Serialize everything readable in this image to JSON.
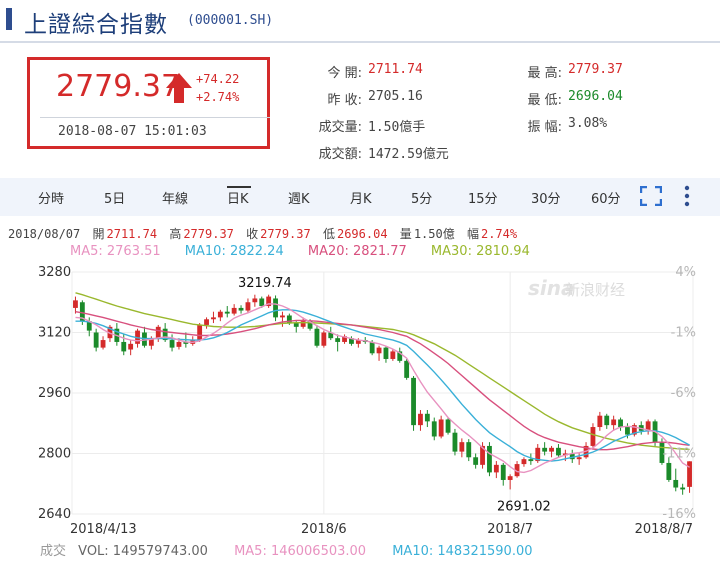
{
  "header": {
    "title": "上證綜合指數",
    "code": "(000001.SH)"
  },
  "quote": {
    "price": "2779.37",
    "change": "+74.22",
    "change_pct": "+2.74%",
    "time": "2018-08-07 15:01:03"
  },
  "stats": [
    {
      "label": "今 開:",
      "value": "2711.74",
      "tone": "red"
    },
    {
      "label": "昨 收:",
      "value": "2705.16",
      "tone": "dark"
    },
    {
      "label": "成交量:",
      "value": "1.50億手",
      "tone": "dark"
    },
    {
      "label": "成交額:",
      "value": "1472.59億元",
      "tone": "dark"
    },
    {
      "label": "最 高:",
      "value": "2779.37",
      "tone": "red"
    },
    {
      "label": "最 低:",
      "value": "2696.04",
      "tone": "green"
    },
    {
      "label": "振 幅:",
      "value": "3.08%",
      "tone": "dark"
    }
  ],
  "tabs": [
    "分時",
    "5日",
    "年線",
    "日K",
    "週K",
    "月K",
    "5分",
    "15分",
    "30分",
    "60分"
  ],
  "active_tab": "日K",
  "info_line": {
    "date": "2018/08/07",
    "open_label": "開",
    "open": "2711.74",
    "high_label": "高",
    "high": "2779.37",
    "close_label": "收",
    "close": "2779.37",
    "low_label": "低",
    "low": "2696.04",
    "vol_label": "量",
    "vol": "1.50億",
    "amp_label": "幅",
    "amp": "2.74%"
  },
  "ma_legend": {
    "ma5": "MA5: 2763.51",
    "ma10": "MA10: 2822.24",
    "ma20": "MA20: 2821.77",
    "ma30": "MA30: 2810.94"
  },
  "volume_line": {
    "label": "成交",
    "vol": "VOL: 149579743.00",
    "ma5": "MA5: 146006503.00",
    "ma10": "MA10: 148321590.00"
  },
  "watermark": "新浪财经",
  "colors": {
    "up": "#d42a2a",
    "down": "#1b8a2a",
    "ma5": "#e892c0",
    "ma10": "#3ab0d8",
    "ma20": "#d8507e",
    "ma30": "#9ab82e",
    "accent": "#2e4d8f"
  },
  "chart_data": {
    "type": "candlestick",
    "ylim": [
      2640,
      3280
    ],
    "y_ticks": [
      "3280",
      "3120",
      "2960",
      "2800",
      "2640"
    ],
    "pct_ticks": [
      "4%",
      "-1%",
      "-6%",
      "-11%",
      "-16%"
    ],
    "x_ticks": [
      "2018/4/13",
      "2018/6",
      "2018/7",
      "2018/8/7"
    ],
    "annotations": {
      "high": "3219.74",
      "low": "2691.02"
    },
    "candles": [
      [
        3185,
        3215,
        3170,
        3205
      ],
      [
        3200,
        3205,
        3140,
        3150
      ],
      [
        3150,
        3160,
        3110,
        3125
      ],
      [
        3120,
        3130,
        3070,
        3080
      ],
      [
        3080,
        3110,
        3075,
        3100
      ],
      [
        3105,
        3140,
        3095,
        3135
      ],
      [
        3130,
        3145,
        3085,
        3095
      ],
      [
        3095,
        3115,
        3060,
        3070
      ],
      [
        3075,
        3100,
        3060,
        3090
      ],
      [
        3090,
        3130,
        3080,
        3125
      ],
      [
        3120,
        3135,
        3080,
        3085
      ],
      [
        3085,
        3110,
        3075,
        3105
      ],
      [
        3105,
        3140,
        3095,
        3135
      ],
      [
        3130,
        3145,
        3095,
        3100
      ],
      [
        3100,
        3115,
        3070,
        3080
      ],
      [
        3082,
        3105,
        3075,
        3095
      ],
      [
        3095,
        3120,
        3080,
        3090
      ],
      [
        3090,
        3110,
        3085,
        3100
      ],
      [
        3100,
        3145,
        3095,
        3140
      ],
      [
        3140,
        3160,
        3130,
        3155
      ],
      [
        3155,
        3175,
        3145,
        3160
      ],
      [
        3160,
        3180,
        3150,
        3175
      ],
      [
        3175,
        3190,
        3160,
        3170
      ],
      [
        3170,
        3195,
        3165,
        3185
      ],
      [
        3185,
        3192,
        3170,
        3178
      ],
      [
        3178,
        3210,
        3172,
        3200
      ],
      [
        3200,
        3220,
        3188,
        3210
      ],
      [
        3210,
        3215,
        3185,
        3190
      ],
      [
        3190,
        3220,
        3185,
        3215
      ],
      [
        3210,
        3218,
        3150,
        3160
      ],
      [
        3160,
        3175,
        3135,
        3165
      ],
      [
        3165,
        3170,
        3140,
        3145
      ],
      [
        3145,
        3150,
        3120,
        3135
      ],
      [
        3135,
        3160,
        3130,
        3150
      ],
      [
        3150,
        3155,
        3125,
        3130
      ],
      [
        3130,
        3140,
        3080,
        3085
      ],
      [
        3085,
        3125,
        3080,
        3120
      ],
      [
        3120,
        3135,
        3100,
        3105
      ],
      [
        3105,
        3115,
        3070,
        3095
      ],
      [
        3095,
        3115,
        3090,
        3110
      ],
      [
        3105,
        3110,
        3085,
        3090
      ],
      [
        3090,
        3105,
        3080,
        3100
      ],
      [
        3100,
        3108,
        3090,
        3095
      ],
      [
        3095,
        3100,
        3060,
        3065
      ],
      [
        3065,
        3085,
        3045,
        3080
      ],
      [
        3080,
        3085,
        3040,
        3050
      ],
      [
        3050,
        3075,
        3045,
        3070
      ],
      [
        3070,
        3080,
        3040,
        3045
      ],
      [
        3045,
        3050,
        2995,
        3000
      ],
      [
        3000,
        3005,
        2860,
        2875
      ],
      [
        2875,
        2915,
        2860,
        2905
      ],
      [
        2905,
        2915,
        2870,
        2885
      ],
      [
        2885,
        2895,
        2835,
        2845
      ],
      [
        2845,
        2900,
        2840,
        2890
      ],
      [
        2890,
        2895,
        2850,
        2855
      ],
      [
        2855,
        2865,
        2795,
        2805
      ],
      [
        2805,
        2840,
        2790,
        2830
      ],
      [
        2830,
        2838,
        2780,
        2790
      ],
      [
        2790,
        2800,
        2760,
        2770
      ],
      [
        2770,
        2830,
        2760,
        2820
      ],
      [
        2820,
        2830,
        2740,
        2750
      ],
      [
        2750,
        2780,
        2735,
        2770
      ],
      [
        2770,
        2775,
        2715,
        2730
      ],
      [
        2730,
        2745,
        2705,
        2740
      ],
      [
        2740,
        2780,
        2736,
        2772
      ],
      [
        2772,
        2790,
        2765,
        2785
      ],
      [
        2785,
        2800,
        2770,
        2780
      ],
      [
        2780,
        2825,
        2775,
        2815
      ],
      [
        2815,
        2830,
        2795,
        2805
      ],
      [
        2805,
        2820,
        2790,
        2815
      ],
      [
        2815,
        2825,
        2790,
        2795
      ],
      [
        2795,
        2810,
        2780,
        2800
      ],
      [
        2800,
        2810,
        2775,
        2785
      ],
      [
        2785,
        2800,
        2770,
        2790
      ],
      [
        2790,
        2830,
        2786,
        2820
      ],
      [
        2820,
        2880,
        2815,
        2870
      ],
      [
        2870,
        2910,
        2860,
        2900
      ],
      [
        2900,
        2905,
        2865,
        2875
      ],
      [
        2875,
        2900,
        2860,
        2890
      ],
      [
        2890,
        2895,
        2860,
        2870
      ],
      [
        2870,
        2880,
        2840,
        2850
      ],
      [
        2850,
        2880,
        2845,
        2875
      ],
      [
        2875,
        2885,
        2850,
        2860
      ],
      [
        2860,
        2890,
        2850,
        2885
      ],
      [
        2885,
        2890,
        2820,
        2830
      ],
      [
        2830,
        2840,
        2770,
        2775
      ],
      [
        2775,
        2790,
        2725,
        2730
      ],
      [
        2730,
        2760,
        2700,
        2710
      ],
      [
        2710,
        2720,
        2691,
        2705
      ],
      [
        2711.74,
        2779.37,
        2696.04,
        2779.37
      ]
    ],
    "ma5": [
      3160,
      3158,
      3150,
      3140,
      3128,
      3118,
      3112,
      3105,
      3100,
      3098,
      3100,
      3102,
      3106,
      3108,
      3106,
      3100,
      3095,
      3094,
      3098,
      3108,
      3118,
      3130,
      3145,
      3158,
      3166,
      3172,
      3180,
      3188,
      3196,
      3195,
      3190,
      3182,
      3170,
      3158,
      3148,
      3138,
      3128,
      3120,
      3112,
      3108,
      3104,
      3100,
      3098,
      3094,
      3090,
      3084,
      3076,
      3066,
      3052,
      3020,
      2990,
      2962,
      2940,
      2918,
      2895,
      2878,
      2862,
      2848,
      2832,
      2815,
      2800,
      2790,
      2780,
      2765,
      2752,
      2750,
      2755,
      2765,
      2775,
      2782,
      2790,
      2796,
      2800,
      2802,
      2806,
      2815,
      2830,
      2848,
      2862,
      2870,
      2872,
      2870,
      2866,
      2862,
      2858,
      2845,
      2825,
      2800,
      2775,
      2763.51
    ],
    "ma10": [
      3150,
      3150,
      3148,
      3144,
      3138,
      3130,
      3122,
      3116,
      3110,
      3106,
      3104,
      3104,
      3104,
      3104,
      3103,
      3102,
      3101,
      3100,
      3100,
      3102,
      3106,
      3112,
      3120,
      3130,
      3140,
      3148,
      3156,
      3164,
      3172,
      3178,
      3180,
      3180,
      3178,
      3174,
      3168,
      3162,
      3155,
      3148,
      3140,
      3134,
      3128,
      3122,
      3116,
      3112,
      3108,
      3104,
      3100,
      3094,
      3086,
      3070,
      3052,
      3034,
      3015,
      2995,
      2974,
      2952,
      2930,
      2910,
      2890,
      2872,
      2855,
      2842,
      2830,
      2818,
      2805,
      2795,
      2788,
      2784,
      2782,
      2780,
      2782,
      2786,
      2790,
      2794,
      2798,
      2804,
      2812,
      2822,
      2832,
      2840,
      2848,
      2854,
      2858,
      2860,
      2860,
      2856,
      2850,
      2842,
      2832,
      2822.24
    ],
    "ma20": [
      3175,
      3172,
      3168,
      3164,
      3160,
      3155,
      3150,
      3145,
      3140,
      3136,
      3132,
      3128,
      3125,
      3122,
      3120,
      3118,
      3116,
      3114,
      3112,
      3112,
      3113,
      3114,
      3116,
      3119,
      3122,
      3126,
      3130,
      3135,
      3140,
      3144,
      3148,
      3150,
      3152,
      3152,
      3151,
      3150,
      3148,
      3146,
      3144,
      3142,
      3140,
      3137,
      3134,
      3131,
      3128,
      3124,
      3120,
      3115,
      3110,
      3100,
      3090,
      3078,
      3065,
      3052,
      3038,
      3022,
      3006,
      2990,
      2974,
      2958,
      2942,
      2928,
      2914,
      2900,
      2886,
      2872,
      2860,
      2850,
      2842,
      2836,
      2830,
      2826,
      2822,
      2818,
      2815,
      2812,
      2810,
      2810,
      2812,
      2815,
      2818,
      2822,
      2826,
      2828,
      2830,
      2830,
      2829,
      2827,
      2824,
      2821.77
    ],
    "ma30": [
      3225,
      3220,
      3214,
      3208,
      3202,
      3196,
      3190,
      3185,
      3180,
      3175,
      3170,
      3166,
      3162,
      3158,
      3154,
      3150,
      3146,
      3142,
      3140,
      3138,
      3136,
      3135,
      3134,
      3134,
      3134,
      3135,
      3136,
      3138,
      3140,
      3142,
      3144,
      3145,
      3146,
      3146,
      3146,
      3145,
      3144,
      3143,
      3142,
      3141,
      3140,
      3138,
      3136,
      3134,
      3132,
      3130,
      3128,
      3124,
      3120,
      3114,
      3106,
      3098,
      3090,
      3080,
      3070,
      3060,
      3048,
      3036,
      3024,
      3012,
      3000,
      2988,
      2976,
      2964,
      2952,
      2940,
      2928,
      2916,
      2904,
      2894,
      2884,
      2876,
      2868,
      2862,
      2856,
      2850,
      2845,
      2840,
      2836,
      2832,
      2828,
      2825,
      2822,
      2820,
      2818,
      2816,
      2815,
      2813,
      2812,
      2810.94
    ]
  }
}
